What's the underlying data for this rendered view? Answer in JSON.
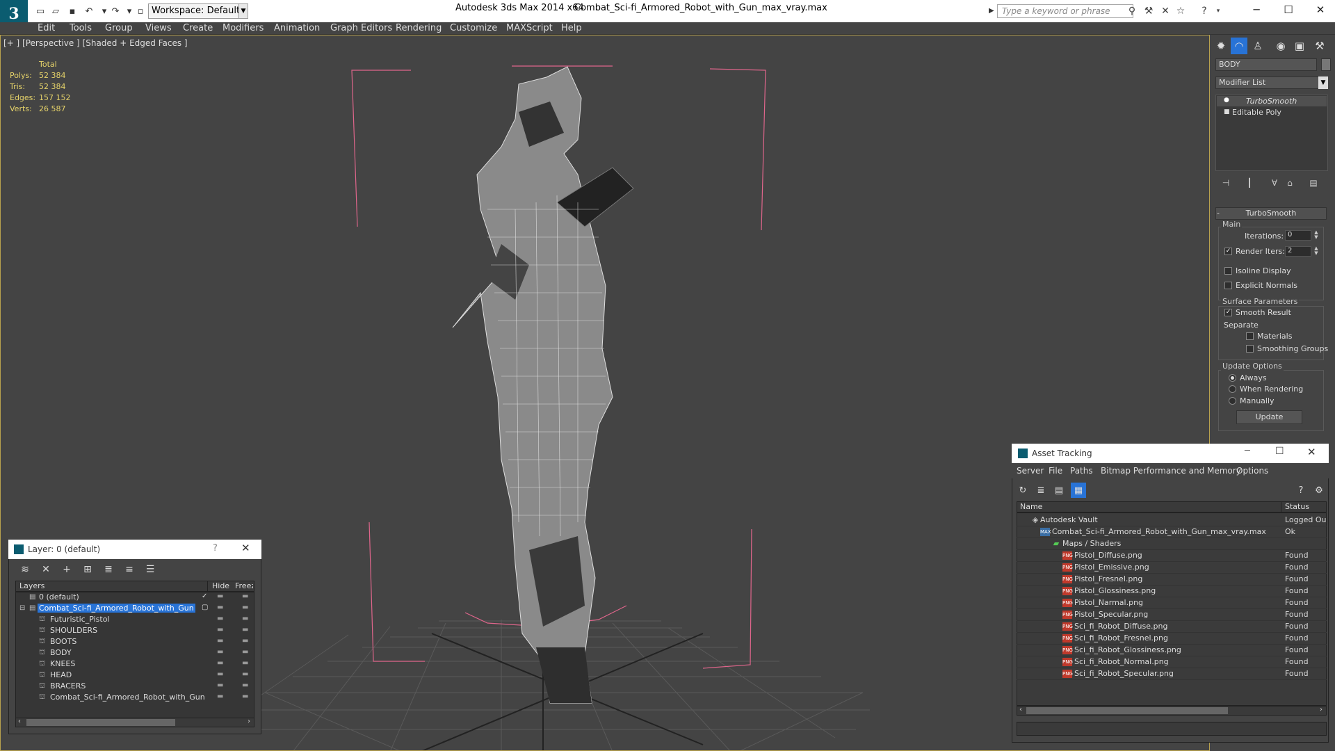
{
  "titlebar": {
    "app_title": "Autodesk 3ds Max  2014 x64",
    "file_title": "Combat_Sci-fi_Armored_Robot_with_Gun_max_vray.max",
    "workspace": "Workspace: Default",
    "search_placeholder": "Type a keyword or phrase"
  },
  "menu": [
    "Edit",
    "Tools",
    "Group",
    "Views",
    "Create",
    "Modifiers",
    "Animation",
    "Graph Editors",
    "Rendering",
    "Customize",
    "MAXScript",
    "Help"
  ],
  "viewport": {
    "label": "[+ ] [Perspective ] [Shaded + Edged Faces ]",
    "stats": {
      "header": "Total",
      "rows": [
        {
          "label": "Polys:",
          "value": "52 384"
        },
        {
          "label": "Tris:",
          "value": "52 384"
        },
        {
          "label": "Edges:",
          "value": "157 152"
        },
        {
          "label": "Verts:",
          "value": "26 587"
        }
      ]
    }
  },
  "command_panel": {
    "object_name": "BODY",
    "modifier_list": "Modifier List",
    "stack": [
      "TurboSmooth",
      "Editable Poly"
    ],
    "rollout_title": "TurboSmooth",
    "main_group": "Main",
    "iterations_label": "Iterations:",
    "iterations_value": "0",
    "render_iters_label": "Render Iters:",
    "render_iters_value": "2",
    "isoline_label": "Isoline Display",
    "explicit_normals_label": "Explicit Normals",
    "surface_group": "Surface Parameters",
    "smooth_result_label": "Smooth Result",
    "separate_label": "Separate",
    "materials_label": "Materials",
    "smoothing_groups_label": "Smoothing Groups",
    "update_group": "Update Options",
    "always_label": "Always",
    "when_rendering_label": "When Rendering",
    "manually_label": "Manually",
    "update_button": "Update"
  },
  "layer_panel": {
    "title": "Layer: 0 (default)",
    "help": "?",
    "columns": [
      "Layers",
      "Hide",
      "Freeze"
    ],
    "rows": [
      {
        "name": "0 (default)",
        "indent": 0
      },
      {
        "name": "Combat_Sci-fi_Armored_Robot_with_Gun",
        "indent": 0
      },
      {
        "name": "Futuristic_Pistol",
        "indent": 1
      },
      {
        "name": "SHOULDERS",
        "indent": 1
      },
      {
        "name": "BOOTS",
        "indent": 1
      },
      {
        "name": "BODY",
        "indent": 1
      },
      {
        "name": "KNEES",
        "indent": 1
      },
      {
        "name": "HEAD",
        "indent": 1
      },
      {
        "name": "BRACERS",
        "indent": 1
      },
      {
        "name": "Combat_Sci-fi_Armored_Robot_with_Gun",
        "indent": 1
      }
    ]
  },
  "asset_tracking": {
    "title": "Asset Tracking",
    "menu": [
      "Server",
      "File",
      "Paths",
      "Bitmap Performance and Memory",
      "Options"
    ],
    "columns": [
      "Name",
      "Status"
    ],
    "rows": [
      {
        "name": "Autodesk Vault",
        "status": "Logged Ou",
        "level": 0,
        "icon": "vault"
      },
      {
        "name": "Combat_Sci-fi_Armored_Robot_with_Gun_max_vray.max",
        "status": "Ok",
        "level": 1,
        "icon": "max"
      },
      {
        "name": "Maps / Shaders",
        "status": "",
        "level": 2,
        "icon": "folder"
      },
      {
        "name": "Pistol_Diffuse.png",
        "status": "Found",
        "level": 3,
        "icon": "png"
      },
      {
        "name": "Pistol_Emissive.png",
        "status": "Found",
        "level": 3,
        "icon": "png"
      },
      {
        "name": "Pistol_Fresnel.png",
        "status": "Found",
        "level": 3,
        "icon": "png"
      },
      {
        "name": "Pistol_Glossiness.png",
        "status": "Found",
        "level": 3,
        "icon": "png"
      },
      {
        "name": "Pistol_Narmal.png",
        "status": "Found",
        "level": 3,
        "icon": "png"
      },
      {
        "name": "Pistol_Specular.png",
        "status": "Found",
        "level": 3,
        "icon": "png"
      },
      {
        "name": "Sci_fi_Robot_Diffuse.png",
        "status": "Found",
        "level": 3,
        "icon": "png"
      },
      {
        "name": "Sci_fi_Robot_Fresnel.png",
        "status": "Found",
        "level": 3,
        "icon": "png"
      },
      {
        "name": "Sci_fi_Robot_Glossiness.png",
        "status": "Found",
        "level": 3,
        "icon": "png"
      },
      {
        "name": "Sci_fi_Robot_Normal.png",
        "status": "Found",
        "level": 3,
        "icon": "png"
      },
      {
        "name": "Sci_fi_Robot_Specular.png",
        "status": "Found",
        "level": 3,
        "icon": "png"
      }
    ]
  },
  "colors": {
    "stats_text": "#e6d36a",
    "viewport_border": "#b9a24e",
    "bbox_pink": "#e0668c",
    "selection_blue": "#2873d6"
  },
  "icon_png_label": "PNG"
}
